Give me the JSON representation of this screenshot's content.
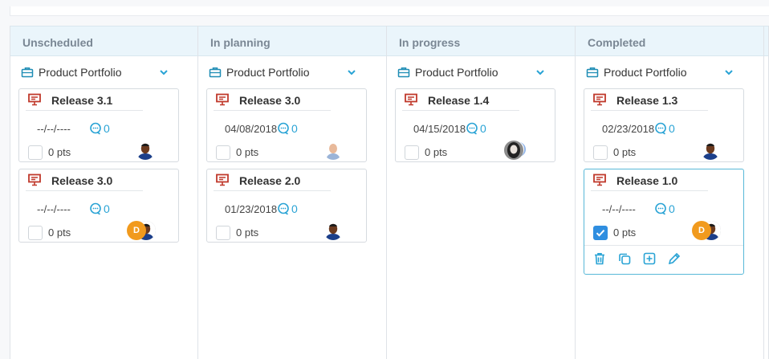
{
  "colors": {
    "accent": "#29a3d5",
    "release_icon": "#c0392b",
    "header_bg": "#eaf5fb",
    "check": "#2f8ee0",
    "avatar_d": "#f19a1d"
  },
  "columns": [
    {
      "title": "Unscheduled",
      "group": "Product Portfolio",
      "cards": [
        {
          "title": "Release 3.1",
          "date": "--/--/----",
          "comments": "0",
          "checked": false,
          "points": "0 pts",
          "avatar": "man"
        },
        {
          "title": "Release 3.0",
          "date": "--/--/----",
          "comments": "0",
          "checked": false,
          "points": "0 pts",
          "avatar": "d",
          "avatar_letter": "D"
        }
      ]
    },
    {
      "title": "In planning",
      "group": "Product Portfolio",
      "cards": [
        {
          "title": "Release 3.0",
          "date": "04/08/2018",
          "comments": "0",
          "checked": false,
          "points": "0 pts",
          "avatar": "bald"
        },
        {
          "title": "Release 2.0",
          "date": "01/23/2018",
          "comments": "0",
          "checked": false,
          "points": "0 pts",
          "avatar": "man"
        }
      ]
    },
    {
      "title": "In progress",
      "group": "Product Portfolio",
      "cards": [
        {
          "title": "Release 1.4",
          "date": "04/15/2018",
          "comments": "0",
          "checked": false,
          "points": "0 pts",
          "avatar": "woman"
        }
      ]
    },
    {
      "title": "Completed",
      "group": "Product Portfolio",
      "cards": [
        {
          "title": "Release 1.3",
          "date": "02/23/2018",
          "comments": "0",
          "checked": false,
          "points": "0 pts",
          "avatar": "man"
        },
        {
          "title": "Release 1.0",
          "date": "--/--/----",
          "comments": "0",
          "checked": true,
          "points": "0 pts",
          "avatar": "d",
          "avatar_letter": "D",
          "active": true
        }
      ]
    }
  ],
  "card_actions": [
    "trash-icon",
    "copy-icon",
    "add-icon",
    "edit-icon"
  ]
}
